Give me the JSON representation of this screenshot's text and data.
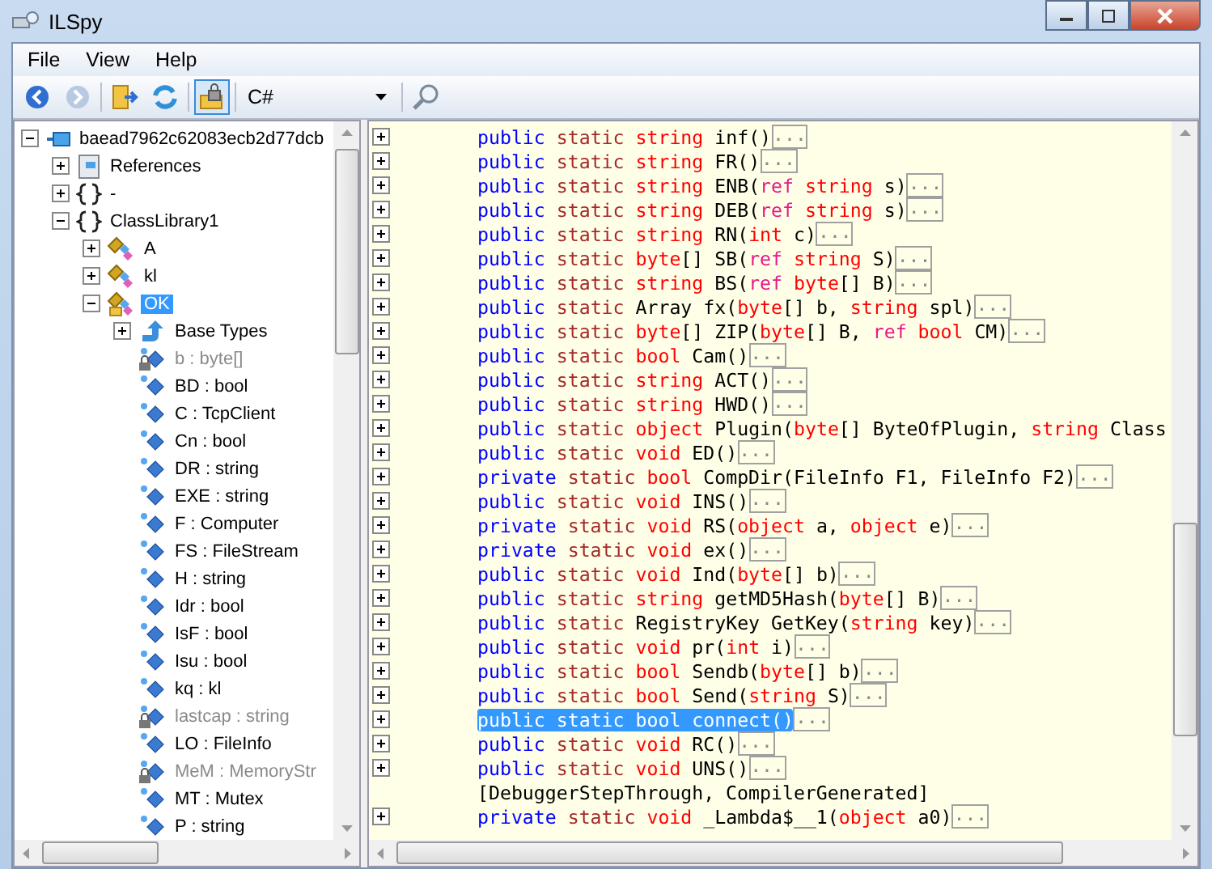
{
  "window": {
    "title": "ILSpy"
  },
  "menu": [
    "File",
    "View",
    "Help"
  ],
  "toolbar": {
    "lock_pressed": true,
    "language": "C#"
  },
  "tree": [
    {
      "label": "baead7962c62083ecb2d77dcb",
      "kind": "assembly",
      "expanded": true,
      "selected": false,
      "children": [
        {
          "label": "References",
          "kind": "references",
          "expanded": false,
          "selected": false
        },
        {
          "label": "-",
          "kind": "namespace",
          "expanded": false,
          "selected": false
        },
        {
          "label": "ClassLibrary1",
          "kind": "namespace",
          "expanded": true,
          "selected": false,
          "children": [
            {
              "label": "A",
              "kind": "class",
              "expanded": false,
              "selected": false
            },
            {
              "label": "kl",
              "kind": "class",
              "expanded": false,
              "selected": false
            },
            {
              "label": "OK",
              "kind": "class",
              "expanded": true,
              "selected": true,
              "children": [
                {
                  "label": "Base Types",
                  "kind": "basetypes",
                  "expanded": false,
                  "selected": false
                },
                {
                  "label": "b : byte[]",
                  "kind": "field",
                  "private": true,
                  "selected": false
                },
                {
                  "label": "BD : bool",
                  "kind": "field",
                  "private": false,
                  "selected": false
                },
                {
                  "label": "C : TcpClient",
                  "kind": "field",
                  "private": false,
                  "selected": false
                },
                {
                  "label": "Cn : bool",
                  "kind": "field",
                  "private": false,
                  "selected": false
                },
                {
                  "label": "DR : string",
                  "kind": "field",
                  "private": false,
                  "selected": false
                },
                {
                  "label": "EXE : string",
                  "kind": "field",
                  "private": false,
                  "selected": false
                },
                {
                  "label": "F : Computer",
                  "kind": "field",
                  "private": false,
                  "selected": false
                },
                {
                  "label": "FS : FileStream",
                  "kind": "field",
                  "private": false,
                  "selected": false
                },
                {
                  "label": "H : string",
                  "kind": "field",
                  "private": false,
                  "selected": false
                },
                {
                  "label": "Idr : bool",
                  "kind": "field",
                  "private": false,
                  "selected": false
                },
                {
                  "label": "IsF : bool",
                  "kind": "field",
                  "private": false,
                  "selected": false
                },
                {
                  "label": "Isu : bool",
                  "kind": "field",
                  "private": false,
                  "selected": false
                },
                {
                  "label": "kq : kl",
                  "kind": "field",
                  "private": false,
                  "selected": false
                },
                {
                  "label": "lastcap : string",
                  "kind": "field",
                  "private": true,
                  "selected": false
                },
                {
                  "label": "LO : FileInfo",
                  "kind": "field",
                  "private": false,
                  "selected": false
                },
                {
                  "label": "MeM : MemoryStr",
                  "kind": "field",
                  "private": true,
                  "selected": false
                },
                {
                  "label": "MT : Mutex",
                  "kind": "field",
                  "private": false,
                  "selected": false
                },
                {
                  "label": "P : string",
                  "kind": "field",
                  "private": false,
                  "selected": false
                }
              ]
            }
          ]
        }
      ]
    }
  ],
  "code": [
    {
      "expander": true,
      "selected": false,
      "body": "...",
      "segments": [
        {
          "kind": "kw",
          "text": "public "
        },
        {
          "kind": "mod",
          "text": "static "
        },
        {
          "kind": "type",
          "text": "string "
        },
        {
          "kind": "plain",
          "text": "inf()"
        }
      ]
    },
    {
      "expander": true,
      "selected": false,
      "body": "...",
      "segments": [
        {
          "kind": "kw",
          "text": "public "
        },
        {
          "kind": "mod",
          "text": "static "
        },
        {
          "kind": "type",
          "text": "string "
        },
        {
          "kind": "plain",
          "text": "FR()"
        }
      ]
    },
    {
      "expander": true,
      "selected": false,
      "body": "...",
      "segments": [
        {
          "kind": "kw",
          "text": "public "
        },
        {
          "kind": "mod",
          "text": "static "
        },
        {
          "kind": "type",
          "text": "string "
        },
        {
          "kind": "plain",
          "text": "ENB("
        },
        {
          "kind": "ref",
          "text": "ref "
        },
        {
          "kind": "type",
          "text": "string "
        },
        {
          "kind": "plain",
          "text": "s)"
        }
      ]
    },
    {
      "expander": true,
      "selected": false,
      "body": "...",
      "segments": [
        {
          "kind": "kw",
          "text": "public "
        },
        {
          "kind": "mod",
          "text": "static "
        },
        {
          "kind": "type",
          "text": "string "
        },
        {
          "kind": "plain",
          "text": "DEB("
        },
        {
          "kind": "ref",
          "text": "ref "
        },
        {
          "kind": "type",
          "text": "string "
        },
        {
          "kind": "plain",
          "text": "s)"
        }
      ]
    },
    {
      "expander": true,
      "selected": false,
      "body": "...",
      "segments": [
        {
          "kind": "kw",
          "text": "public "
        },
        {
          "kind": "mod",
          "text": "static "
        },
        {
          "kind": "type",
          "text": "string "
        },
        {
          "kind": "plain",
          "text": "RN("
        },
        {
          "kind": "type",
          "text": "int "
        },
        {
          "kind": "plain",
          "text": "c)"
        }
      ]
    },
    {
      "expander": true,
      "selected": false,
      "body": "...",
      "segments": [
        {
          "kind": "kw",
          "text": "public "
        },
        {
          "kind": "mod",
          "text": "static "
        },
        {
          "kind": "type",
          "text": "byte"
        },
        {
          "kind": "plain",
          "text": "[] SB("
        },
        {
          "kind": "ref",
          "text": "ref "
        },
        {
          "kind": "type",
          "text": "string "
        },
        {
          "kind": "plain",
          "text": "S)"
        }
      ]
    },
    {
      "expander": true,
      "selected": false,
      "body": "...",
      "segments": [
        {
          "kind": "kw",
          "text": "public "
        },
        {
          "kind": "mod",
          "text": "static "
        },
        {
          "kind": "type",
          "text": "string "
        },
        {
          "kind": "plain",
          "text": "BS("
        },
        {
          "kind": "ref",
          "text": "ref "
        },
        {
          "kind": "type",
          "text": "byte"
        },
        {
          "kind": "plain",
          "text": "[] B)"
        }
      ]
    },
    {
      "expander": true,
      "selected": false,
      "body": "...",
      "segments": [
        {
          "kind": "kw",
          "text": "public "
        },
        {
          "kind": "mod",
          "text": "static "
        },
        {
          "kind": "plain",
          "text": "Array fx("
        },
        {
          "kind": "type",
          "text": "byte"
        },
        {
          "kind": "plain",
          "text": "[] b, "
        },
        {
          "kind": "type",
          "text": "string "
        },
        {
          "kind": "plain",
          "text": "spl)"
        }
      ]
    },
    {
      "expander": true,
      "selected": false,
      "body": "...",
      "segments": [
        {
          "kind": "kw",
          "text": "public "
        },
        {
          "kind": "mod",
          "text": "static "
        },
        {
          "kind": "type",
          "text": "byte"
        },
        {
          "kind": "plain",
          "text": "[] ZIP("
        },
        {
          "kind": "type",
          "text": "byte"
        },
        {
          "kind": "plain",
          "text": "[] B, "
        },
        {
          "kind": "ref",
          "text": "ref "
        },
        {
          "kind": "type",
          "text": "bool "
        },
        {
          "kind": "plain",
          "text": "CM)"
        }
      ]
    },
    {
      "expander": true,
      "selected": false,
      "body": "...",
      "segments": [
        {
          "kind": "kw",
          "text": "public "
        },
        {
          "kind": "mod",
          "text": "static "
        },
        {
          "kind": "type",
          "text": "bool "
        },
        {
          "kind": "plain",
          "text": "Cam()"
        }
      ]
    },
    {
      "expander": true,
      "selected": false,
      "body": "...",
      "segments": [
        {
          "kind": "kw",
          "text": "public "
        },
        {
          "kind": "mod",
          "text": "static "
        },
        {
          "kind": "type",
          "text": "string "
        },
        {
          "kind": "plain",
          "text": "ACT()"
        }
      ]
    },
    {
      "expander": true,
      "selected": false,
      "body": "...",
      "segments": [
        {
          "kind": "kw",
          "text": "public "
        },
        {
          "kind": "mod",
          "text": "static "
        },
        {
          "kind": "type",
          "text": "string "
        },
        {
          "kind": "plain",
          "text": "HWD()"
        }
      ]
    },
    {
      "expander": true,
      "selected": false,
      "segments": [
        {
          "kind": "kw",
          "text": "public "
        },
        {
          "kind": "mod",
          "text": "static "
        },
        {
          "kind": "type",
          "text": "object "
        },
        {
          "kind": "plain",
          "text": "Plugin("
        },
        {
          "kind": "type",
          "text": "byte"
        },
        {
          "kind": "plain",
          "text": "[] ByteOfPlugin, "
        },
        {
          "kind": "type",
          "text": "string "
        },
        {
          "kind": "plain",
          "text": "Class"
        }
      ]
    },
    {
      "expander": true,
      "selected": false,
      "body": "...",
      "segments": [
        {
          "kind": "kw",
          "text": "public "
        },
        {
          "kind": "mod",
          "text": "static "
        },
        {
          "kind": "type",
          "text": "void "
        },
        {
          "kind": "plain",
          "text": "ED()"
        }
      ]
    },
    {
      "expander": true,
      "selected": false,
      "body": "...",
      "segments": [
        {
          "kind": "kw",
          "text": "private "
        },
        {
          "kind": "mod",
          "text": "static "
        },
        {
          "kind": "type",
          "text": "bool "
        },
        {
          "kind": "plain",
          "text": "CompDir(FileInfo F1, FileInfo F2)"
        }
      ]
    },
    {
      "expander": true,
      "selected": false,
      "body": "...",
      "segments": [
        {
          "kind": "kw",
          "text": "public "
        },
        {
          "kind": "mod",
          "text": "static "
        },
        {
          "kind": "type",
          "text": "void "
        },
        {
          "kind": "plain",
          "text": "INS()"
        }
      ]
    },
    {
      "expander": true,
      "selected": false,
      "body": "...",
      "segments": [
        {
          "kind": "kw",
          "text": "private "
        },
        {
          "kind": "mod",
          "text": "static "
        },
        {
          "kind": "type",
          "text": "void "
        },
        {
          "kind": "plain",
          "text": "RS("
        },
        {
          "kind": "type",
          "text": "object "
        },
        {
          "kind": "plain",
          "text": "a, "
        },
        {
          "kind": "type",
          "text": "object "
        },
        {
          "kind": "plain",
          "text": "e)"
        }
      ]
    },
    {
      "expander": true,
      "selected": false,
      "body": "...",
      "segments": [
        {
          "kind": "kw",
          "text": "private "
        },
        {
          "kind": "mod",
          "text": "static "
        },
        {
          "kind": "type",
          "text": "void "
        },
        {
          "kind": "plain",
          "text": "ex()"
        }
      ]
    },
    {
      "expander": true,
      "selected": false,
      "body": "...",
      "segments": [
        {
          "kind": "kw",
          "text": "public "
        },
        {
          "kind": "mod",
          "text": "static "
        },
        {
          "kind": "type",
          "text": "void "
        },
        {
          "kind": "plain",
          "text": "Ind("
        },
        {
          "kind": "type",
          "text": "byte"
        },
        {
          "kind": "plain",
          "text": "[] b)"
        }
      ]
    },
    {
      "expander": true,
      "selected": false,
      "body": "...",
      "segments": [
        {
          "kind": "kw",
          "text": "public "
        },
        {
          "kind": "mod",
          "text": "static "
        },
        {
          "kind": "type",
          "text": "string "
        },
        {
          "kind": "plain",
          "text": "getMD5Hash("
        },
        {
          "kind": "type",
          "text": "byte"
        },
        {
          "kind": "plain",
          "text": "[] B)"
        }
      ]
    },
    {
      "expander": true,
      "selected": false,
      "body": "...",
      "segments": [
        {
          "kind": "kw",
          "text": "public "
        },
        {
          "kind": "mod",
          "text": "static "
        },
        {
          "kind": "plain",
          "text": "RegistryKey GetKey("
        },
        {
          "kind": "type",
          "text": "string "
        },
        {
          "kind": "plain",
          "text": "key)"
        }
      ]
    },
    {
      "expander": true,
      "selected": false,
      "body": "...",
      "segments": [
        {
          "kind": "kw",
          "text": "public "
        },
        {
          "kind": "mod",
          "text": "static "
        },
        {
          "kind": "type",
          "text": "void "
        },
        {
          "kind": "plain",
          "text": "pr("
        },
        {
          "kind": "type",
          "text": "int "
        },
        {
          "kind": "plain",
          "text": "i)"
        }
      ]
    },
    {
      "expander": true,
      "selected": false,
      "body": "...",
      "segments": [
        {
          "kind": "kw",
          "text": "public "
        },
        {
          "kind": "mod",
          "text": "static "
        },
        {
          "kind": "type",
          "text": "bool "
        },
        {
          "kind": "plain",
          "text": "Sendb("
        },
        {
          "kind": "type",
          "text": "byte"
        },
        {
          "kind": "plain",
          "text": "[] b)"
        }
      ]
    },
    {
      "expander": true,
      "selected": false,
      "body": "...",
      "segments": [
        {
          "kind": "kw",
          "text": "public "
        },
        {
          "kind": "mod",
          "text": "static "
        },
        {
          "kind": "type",
          "text": "bool "
        },
        {
          "kind": "plain",
          "text": "Send("
        },
        {
          "kind": "type",
          "text": "string "
        },
        {
          "kind": "plain",
          "text": "S)"
        }
      ]
    },
    {
      "expander": true,
      "selected": true,
      "body": "...",
      "segments": [
        {
          "kind": "kw",
          "text": "public "
        },
        {
          "kind": "mod",
          "text": "static "
        },
        {
          "kind": "type",
          "text": "bool "
        },
        {
          "kind": "plain",
          "text": "connect()"
        }
      ]
    },
    {
      "expander": true,
      "selected": false,
      "body": "...",
      "segments": [
        {
          "kind": "kw",
          "text": "public "
        },
        {
          "kind": "mod",
          "text": "static "
        },
        {
          "kind": "type",
          "text": "void "
        },
        {
          "kind": "plain",
          "text": "RC()"
        }
      ]
    },
    {
      "expander": true,
      "selected": false,
      "body": "...",
      "segments": [
        {
          "kind": "kw",
          "text": "public "
        },
        {
          "kind": "mod",
          "text": "static "
        },
        {
          "kind": "type",
          "text": "void "
        },
        {
          "kind": "plain",
          "text": "UNS()"
        }
      ]
    },
    {
      "expander": false,
      "selected": false,
      "segments": [
        {
          "kind": "plain",
          "text": "[DebuggerStepThrough, CompilerGenerated]"
        }
      ]
    },
    {
      "expander": true,
      "selected": false,
      "body": "...",
      "segments": [
        {
          "kind": "kw",
          "text": "private "
        },
        {
          "kind": "mod",
          "text": "static "
        },
        {
          "kind": "type",
          "text": "void "
        },
        {
          "kind": "plain",
          "text": "_Lambda$__1("
        },
        {
          "kind": "type",
          "text": "object "
        },
        {
          "kind": "plain",
          "text": "a0)"
        }
      ]
    }
  ]
}
